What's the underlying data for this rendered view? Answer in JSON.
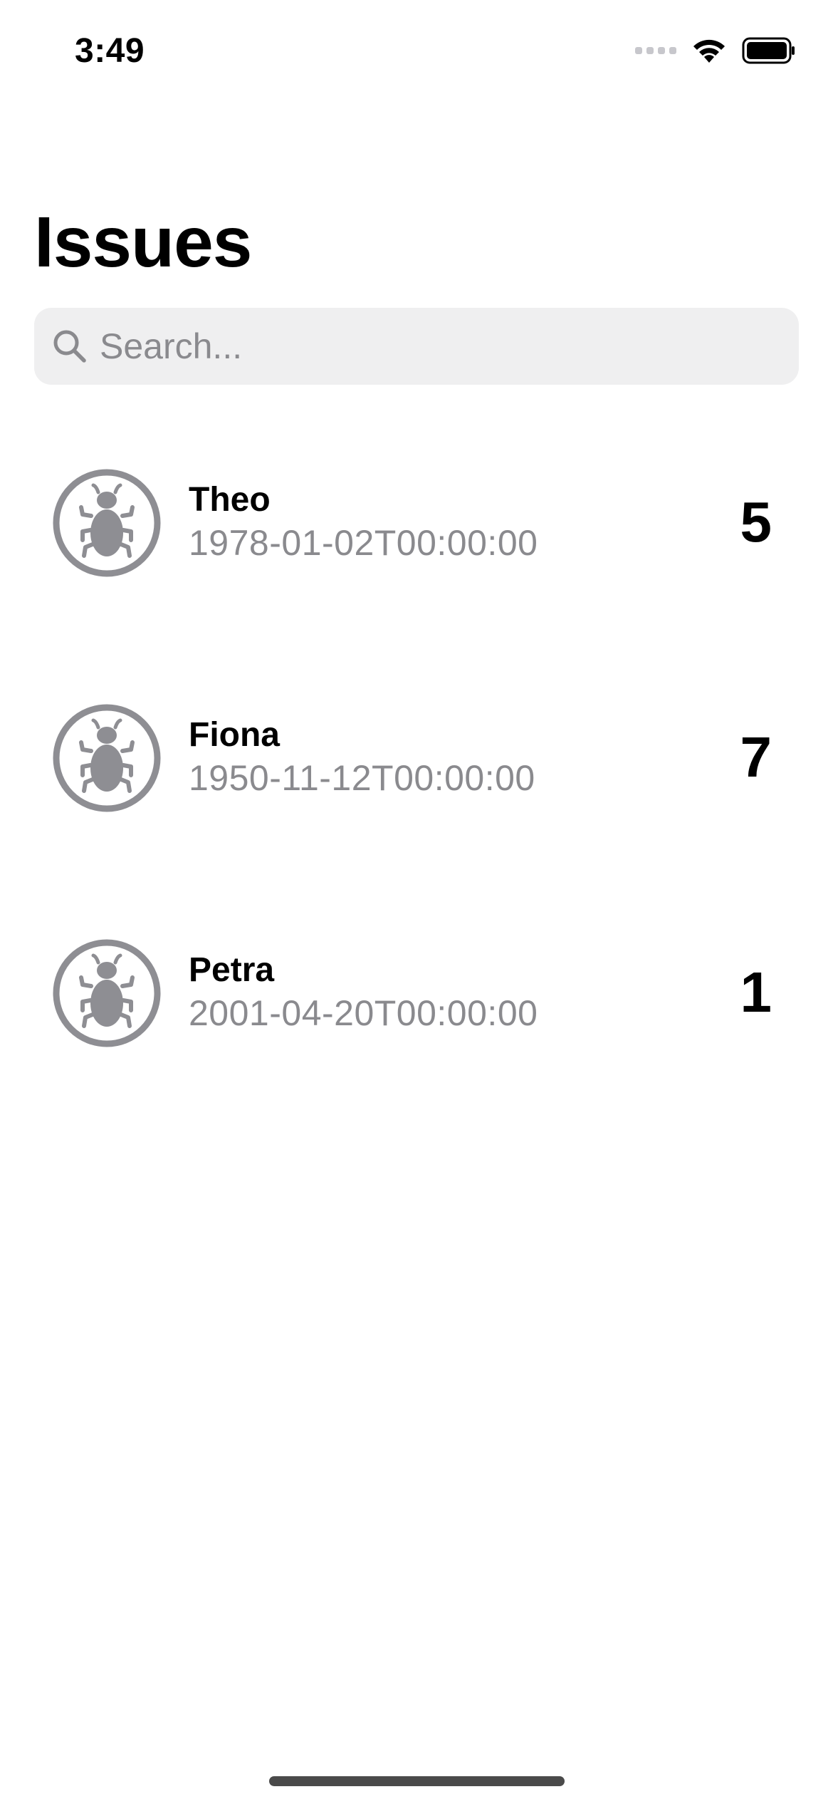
{
  "status_bar": {
    "time": "3:49"
  },
  "header": {
    "title": "Issues"
  },
  "search": {
    "placeholder": "Search...",
    "value": ""
  },
  "issues": [
    {
      "name": "Theo",
      "date": "1978-01-02T00:00:00",
      "count": "5",
      "icon": "bug-icon"
    },
    {
      "name": "Fiona",
      "date": "1950-11-12T00:00:00",
      "count": "7",
      "icon": "bug-icon"
    },
    {
      "name": "Petra",
      "date": "2001-04-20T00:00:00",
      "count": "1",
      "icon": "bug-icon"
    }
  ],
  "colors": {
    "icon_gray": "#8e8e93",
    "secondary_text": "#8a8a8e",
    "search_background": "#efeff0"
  }
}
